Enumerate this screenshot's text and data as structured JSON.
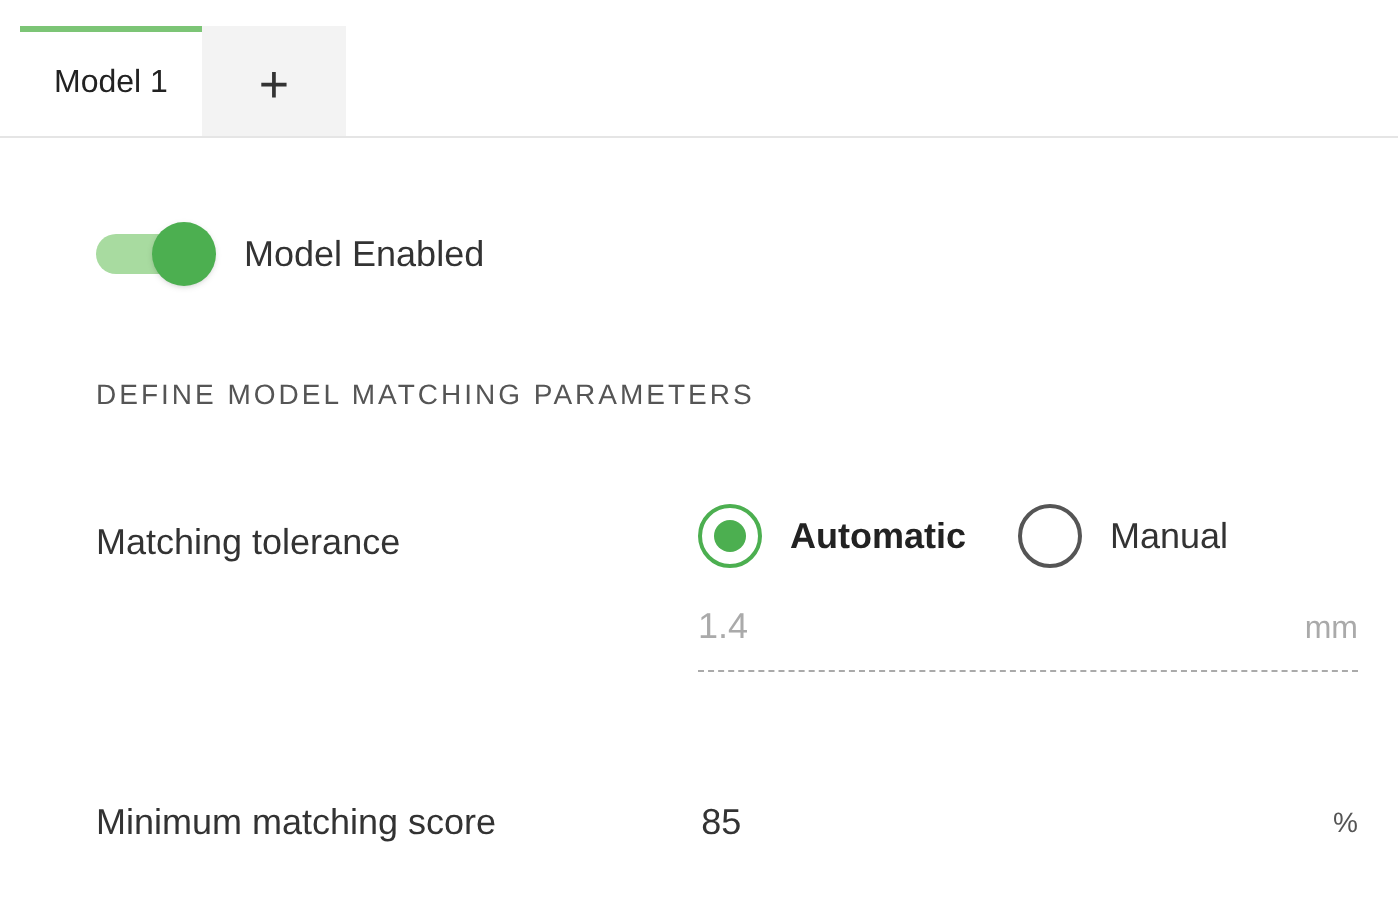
{
  "tabs": [
    {
      "label": "Model 1",
      "selected": true
    },
    {
      "label": "+",
      "selected": false
    }
  ],
  "toggle": {
    "label": "Model Enabled",
    "on": true
  },
  "section_heading": "DEFINE MODEL MATCHING PARAMETERS",
  "tolerance": {
    "label": "Matching tolerance",
    "options": [
      {
        "label": "Automatic",
        "selected": true
      },
      {
        "label": "Manual",
        "selected": false
      }
    ],
    "field": {
      "value": "1.4",
      "unit": "mm",
      "disabled": true
    }
  },
  "score": {
    "label": "Minimum matching score",
    "value": "85",
    "unit": "%"
  }
}
